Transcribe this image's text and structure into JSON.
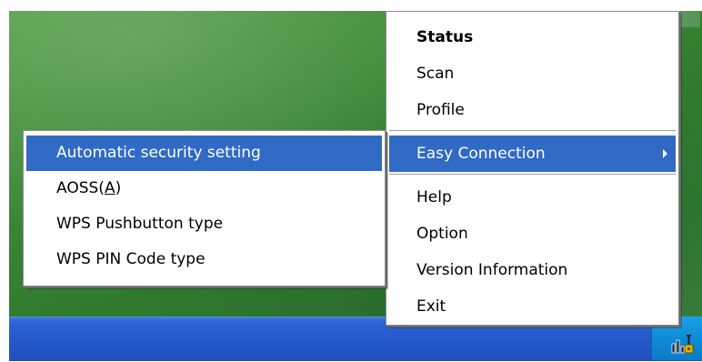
{
  "tray_menu": {
    "items_top": [
      {
        "label": "Status",
        "bold": true
      },
      {
        "label": "Scan"
      },
      {
        "label": "Profile"
      }
    ],
    "easy_connection": {
      "label": "Easy Connection",
      "highlighted": true,
      "has_submenu": true
    },
    "items_bottom": [
      {
        "label": "Help"
      },
      {
        "label": "Option"
      },
      {
        "label": "Version Information"
      },
      {
        "label": "Exit"
      }
    ]
  },
  "easy_connection_submenu": {
    "items": [
      {
        "label": "Automatic security setting",
        "highlighted": true
      },
      {
        "label_prefix": "AOSS(",
        "accelerator": "A",
        "label_suffix": ")"
      },
      {
        "label": "WPS Pushbutton type"
      },
      {
        "label": "WPS PIN Code type"
      }
    ]
  },
  "icons": {
    "tray_icon": "wireless-signal-icon",
    "submenu_arrow": "submenu-arrow-icon"
  },
  "colors": {
    "highlight": "#316ac5",
    "taskbar": "#2458c9",
    "tray": "#0d8bd8",
    "desktop": "#3f8a37"
  }
}
